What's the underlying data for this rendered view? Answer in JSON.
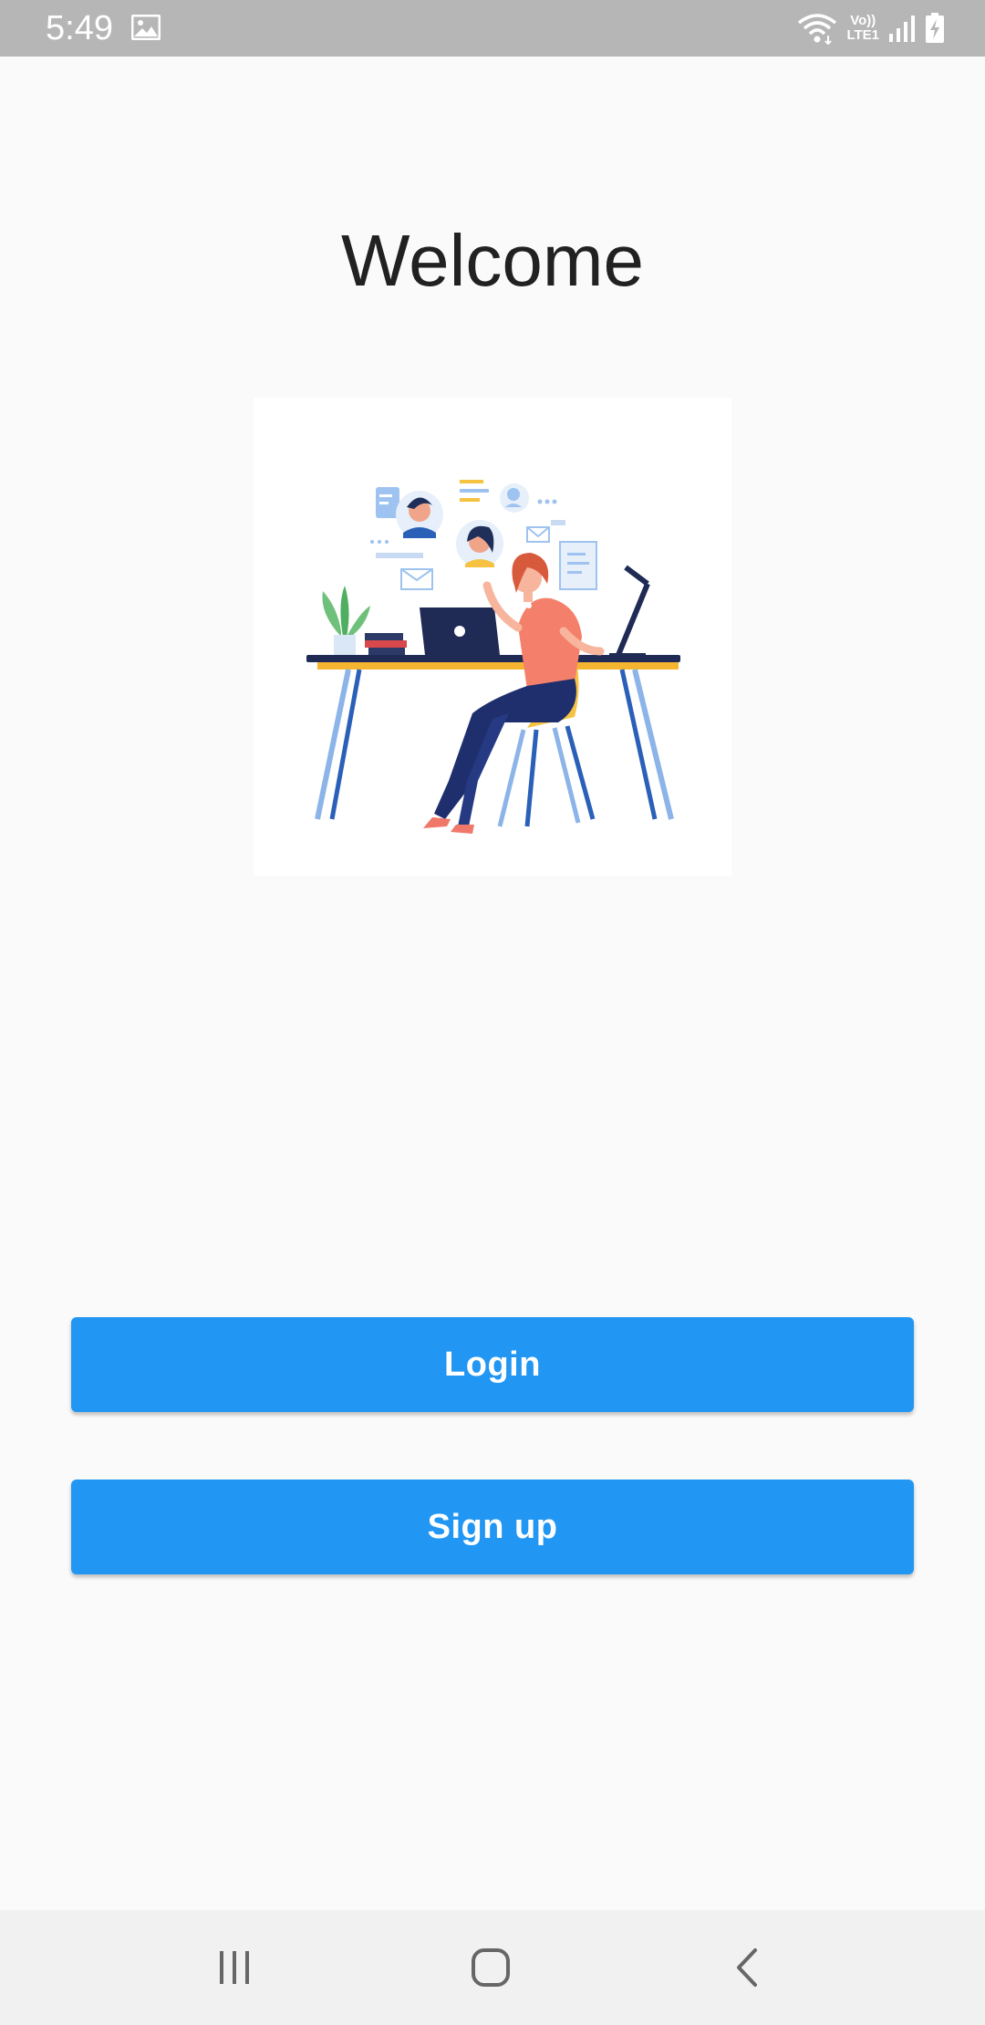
{
  "status_bar": {
    "time": "5:49",
    "network_label_top": "Vo))",
    "network_label_bottom": "LTE1",
    "icons": [
      "gallery-icon",
      "wifi-icon",
      "signal-icon",
      "battery-charging-icon"
    ]
  },
  "main": {
    "title": "Welcome",
    "illustration": "person-at-desk-with-laptop-illustration",
    "login_label": "Login",
    "signup_label": "Sign up"
  },
  "nav_bar": {
    "icons": [
      "recent-apps-icon",
      "home-icon",
      "back-icon"
    ]
  },
  "colors": {
    "accent": "#2196f3",
    "background": "#fafafa",
    "status_bar": "#b6b6b6",
    "nav_bar": "#f1f1f1",
    "title_text": "#212121"
  }
}
